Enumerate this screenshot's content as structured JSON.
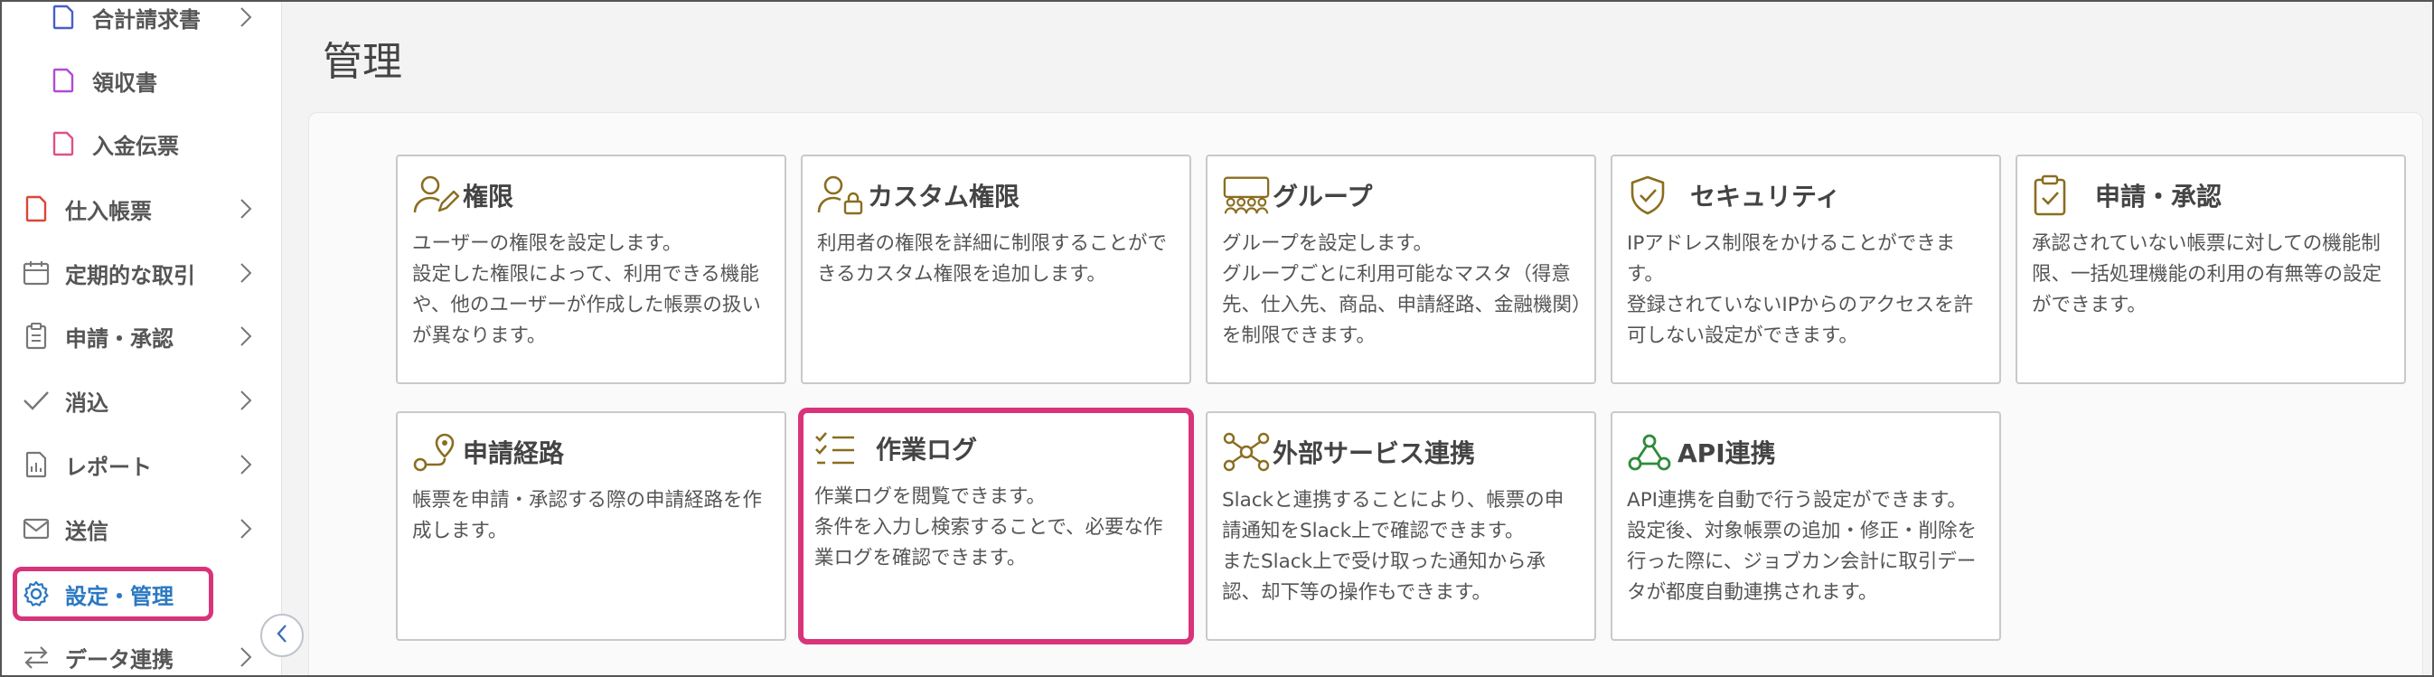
{
  "sidebar": {
    "items": [
      {
        "label": "合計請求書",
        "icon": "document-icon"
      },
      {
        "label": "領収書",
        "icon": "document-icon"
      },
      {
        "label": "入金伝票",
        "icon": "document-icon"
      },
      {
        "label": "仕入帳票",
        "icon": "document-icon"
      },
      {
        "label": "定期的な取引",
        "icon": "calendar-icon"
      },
      {
        "label": "申請・承認",
        "icon": "clipboard-icon"
      },
      {
        "label": "消込",
        "icon": "check-icon"
      },
      {
        "label": "レポート",
        "icon": "report-icon"
      },
      {
        "label": "送信",
        "icon": "mail-icon"
      },
      {
        "label": "設定・管理",
        "icon": "gear-icon"
      },
      {
        "label": "データ連携",
        "icon": "arrows-icon"
      }
    ],
    "collapse_icon": "chevron-left-icon"
  },
  "main": {
    "title": "管理",
    "cards": [
      {
        "title": "権限",
        "icon": "user-edit-icon",
        "desc": "ユーザーの権限を設定します。\n設定した権限によって、利用できる機能や、他のユーザーが作成した帳票の扱いが異なります。"
      },
      {
        "title": "カスタム権限",
        "icon": "user-lock-icon",
        "desc": "利用者の権限を詳細に制限することができるカスタム権限を追加します。"
      },
      {
        "title": "グループ",
        "icon": "group-icon",
        "desc": "グループを設定します。\nグループごとに利用可能なマスタ（得意先、仕入先、商品、申請経路、金融機関）を制限できます。"
      },
      {
        "title": "セキュリティ",
        "icon": "shield-check-icon",
        "desc": "IPアドレス制限をかけることができます。\n登録されていないIPからのアクセスを許可しない設定ができます。"
      },
      {
        "title": "申請・承認",
        "icon": "clipboard-check-icon",
        "desc": "承認されていない帳票に対しての機能制限、一括処理機能の利用の有無等の設定ができます。"
      },
      {
        "title": "申請経路",
        "icon": "route-icon",
        "desc": "帳票を申請・承認する際の申請経路を作成します。"
      },
      {
        "title": "作業ログ",
        "icon": "checklist-icon",
        "desc": "作業ログを閲覧できます。\n条件を入力し検索することで、必要な作業ログを確認できます。"
      },
      {
        "title": "外部サービス連携",
        "icon": "network-icon",
        "desc": "Slackと連携することにより、帳票の申請通知をSlack上で確認できます。\nまたSlack上で受け取った通知から承認、却下等の操作もできます。"
      },
      {
        "title": "API連携",
        "icon": "webhook-icon",
        "desc": "API連携を自動で行う設定ができます。\n設定後、対象帳票の追加・修正・削除を行った際に、ジョブカン会計に取引データが都度自動連携されます。"
      }
    ]
  },
  "colors": {
    "accent": "#d9337a",
    "active_text": "#2b78c2",
    "card_icon": "#8a6d1f",
    "api_icon": "#2e8b3a"
  }
}
